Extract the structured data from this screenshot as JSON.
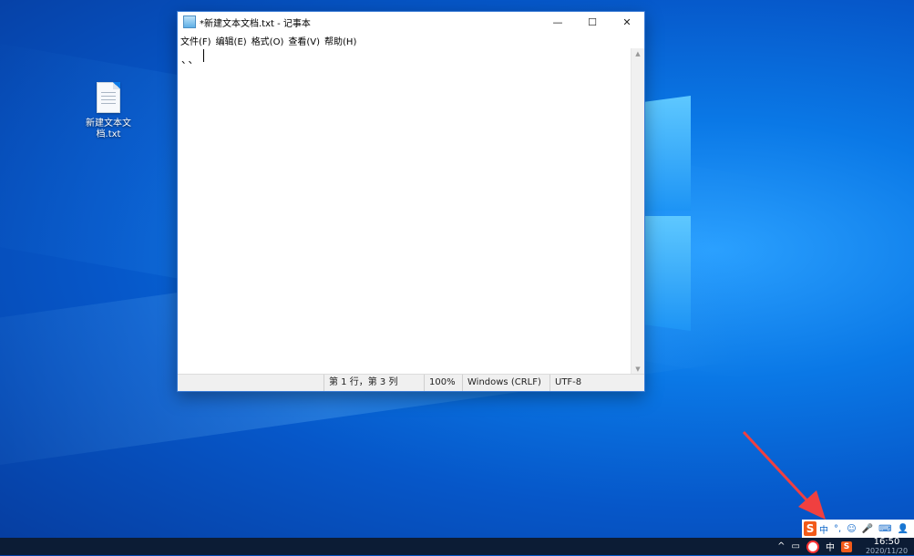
{
  "desktop": {
    "icon_label": "新建文本文档.txt"
  },
  "notepad": {
    "title": "*新建文本文档.txt - 记事本",
    "buttons": {
      "minimize": "—",
      "maximize": "☐",
      "close": "✕"
    },
    "menu": [
      "文件(F)",
      "编辑(E)",
      "格式(O)",
      "查看(V)",
      "帮助(H)"
    ],
    "content": "、、",
    "status": {
      "position": "第 1 行，第 3 列",
      "zoom": "100%",
      "line_ending": "Windows (CRLF)",
      "encoding": "UTF-8"
    }
  },
  "ime_toolbar": {
    "logo": "S",
    "mode": "中",
    "punct": "°,",
    "emoji_icon": "smile-icon",
    "mic_icon": "mic-icon",
    "keyboard_icon": "keyboard-icon",
    "user_icon": "user-icon"
  },
  "taskbar": {
    "tray_ime": "中",
    "tray_ime_logo": "S",
    "time": "16:50",
    "date": "2020/11/20"
  },
  "colors": {
    "accent": "#3a7bd5",
    "arrow": "#f04040",
    "sogou": "#f25a19"
  }
}
